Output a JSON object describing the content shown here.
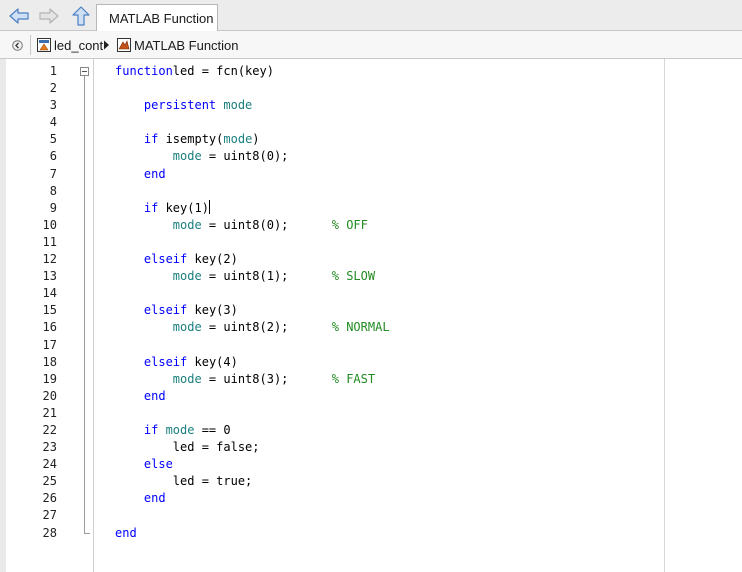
{
  "toolbar": {
    "back_icon": "back-arrow-icon",
    "forward_icon": "forward-arrow-icon",
    "up_icon": "up-arrow-icon",
    "tab_label": "MATLAB Function"
  },
  "breadcrumb": {
    "collapse_icon": "collapse-icon",
    "items": [
      {
        "label": "led_cont",
        "icon": "simulink-model-icon"
      },
      {
        "label": "MATLAB Function",
        "icon": "matlab-function-icon"
      }
    ],
    "separator_icon": "chevron-right-icon"
  },
  "editor": {
    "cursor_line": 9,
    "lines": [
      {
        "n": "1",
        "tokens": [
          [
            "kw",
            "function"
          ],
          [
            "",
            "led = fcn(key)"
          ]
        ]
      },
      {
        "n": "2",
        "tokens": []
      },
      {
        "n": "3",
        "tokens": [
          [
            "",
            "    "
          ],
          [
            "kw",
            "persistent"
          ],
          [
            "",
            ""
          ],
          [
            "var",
            " mode"
          ]
        ]
      },
      {
        "n": "4",
        "tokens": []
      },
      {
        "n": "5",
        "tokens": [
          [
            "",
            "    "
          ],
          [
            "kw",
            "if"
          ],
          [
            "",
            " isempty("
          ],
          [
            "var",
            "mode"
          ],
          [
            "",
            ")"
          ]
        ]
      },
      {
        "n": "6",
        "tokens": [
          [
            "",
            "        "
          ],
          [
            "var",
            "mode"
          ],
          [
            "",
            " = uint8(0);"
          ]
        ]
      },
      {
        "n": "7",
        "tokens": [
          [
            "",
            "    "
          ],
          [
            "kw",
            "end"
          ]
        ]
      },
      {
        "n": "8",
        "tokens": []
      },
      {
        "n": "9",
        "tokens": [
          [
            "",
            "    "
          ],
          [
            "kw",
            "if"
          ],
          [
            "",
            " key(1)"
          ]
        ]
      },
      {
        "n": "10",
        "tokens": [
          [
            "",
            "        "
          ],
          [
            "var",
            "mode"
          ],
          [
            "",
            " = uint8(0);      "
          ],
          [
            "cm",
            "% OFF"
          ]
        ]
      },
      {
        "n": "11",
        "tokens": []
      },
      {
        "n": "12",
        "tokens": [
          [
            "",
            "    "
          ],
          [
            "kw",
            "elseif"
          ],
          [
            "",
            " key(2)"
          ]
        ]
      },
      {
        "n": "13",
        "tokens": [
          [
            "",
            "        "
          ],
          [
            "var",
            "mode"
          ],
          [
            "",
            " = uint8(1);      "
          ],
          [
            "cm",
            "% SLOW"
          ]
        ]
      },
      {
        "n": "14",
        "tokens": []
      },
      {
        "n": "15",
        "tokens": [
          [
            "",
            "    "
          ],
          [
            "kw",
            "elseif"
          ],
          [
            "",
            " key(3)"
          ]
        ]
      },
      {
        "n": "16",
        "tokens": [
          [
            "",
            "        "
          ],
          [
            "var",
            "mode"
          ],
          [
            "",
            " = uint8(2);      "
          ],
          [
            "cm",
            "% NORMAL"
          ]
        ]
      },
      {
        "n": "17",
        "tokens": []
      },
      {
        "n": "18",
        "tokens": [
          [
            "",
            "    "
          ],
          [
            "kw",
            "elseif"
          ],
          [
            "",
            " key(4)"
          ]
        ]
      },
      {
        "n": "19",
        "tokens": [
          [
            "",
            "        "
          ],
          [
            "var",
            "mode"
          ],
          [
            "",
            " = uint8(3);      "
          ],
          [
            "cm",
            "% FAST"
          ]
        ]
      },
      {
        "n": "20",
        "tokens": [
          [
            "",
            "    "
          ],
          [
            "kw",
            "end"
          ]
        ]
      },
      {
        "n": "21",
        "tokens": []
      },
      {
        "n": "22",
        "tokens": [
          [
            "",
            "    "
          ],
          [
            "kw",
            "if"
          ],
          [
            "var",
            " mode"
          ],
          [
            "",
            " == 0"
          ]
        ]
      },
      {
        "n": "23",
        "tokens": [
          [
            "",
            "        led = false;"
          ]
        ]
      },
      {
        "n": "24",
        "tokens": [
          [
            "",
            "    "
          ],
          [
            "kw",
            "else"
          ]
        ]
      },
      {
        "n": "25",
        "tokens": [
          [
            "",
            "        led = true;"
          ]
        ]
      },
      {
        "n": "26",
        "tokens": [
          [
            "",
            "    "
          ],
          [
            "kw",
            "end"
          ]
        ]
      },
      {
        "n": "27",
        "tokens": []
      },
      {
        "n": "28",
        "tokens": [
          [
            "kw",
            "end"
          ]
        ]
      }
    ]
  },
  "colors": {
    "keyword": "#0000ff",
    "variable": "#1c7f7f",
    "comment": "#228b22"
  }
}
